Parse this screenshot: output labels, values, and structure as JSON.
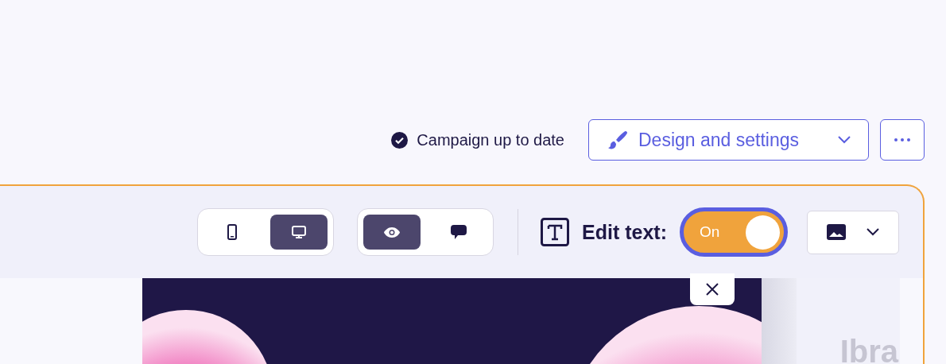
{
  "header": {
    "status": "Campaign up to date",
    "design_button": "Design and settings"
  },
  "toolbar": {
    "device_modes": [
      {
        "kind": "mobile",
        "selected": false
      },
      {
        "kind": "desktop",
        "selected": true
      }
    ],
    "view_modes": [
      {
        "kind": "preview",
        "selected": true
      },
      {
        "kind": "comments",
        "selected": false
      }
    ],
    "edit_text": {
      "label": "Edit text:",
      "on": true,
      "state_label": "On"
    }
  },
  "canvas": {
    "side_text": "Ibra"
  }
}
